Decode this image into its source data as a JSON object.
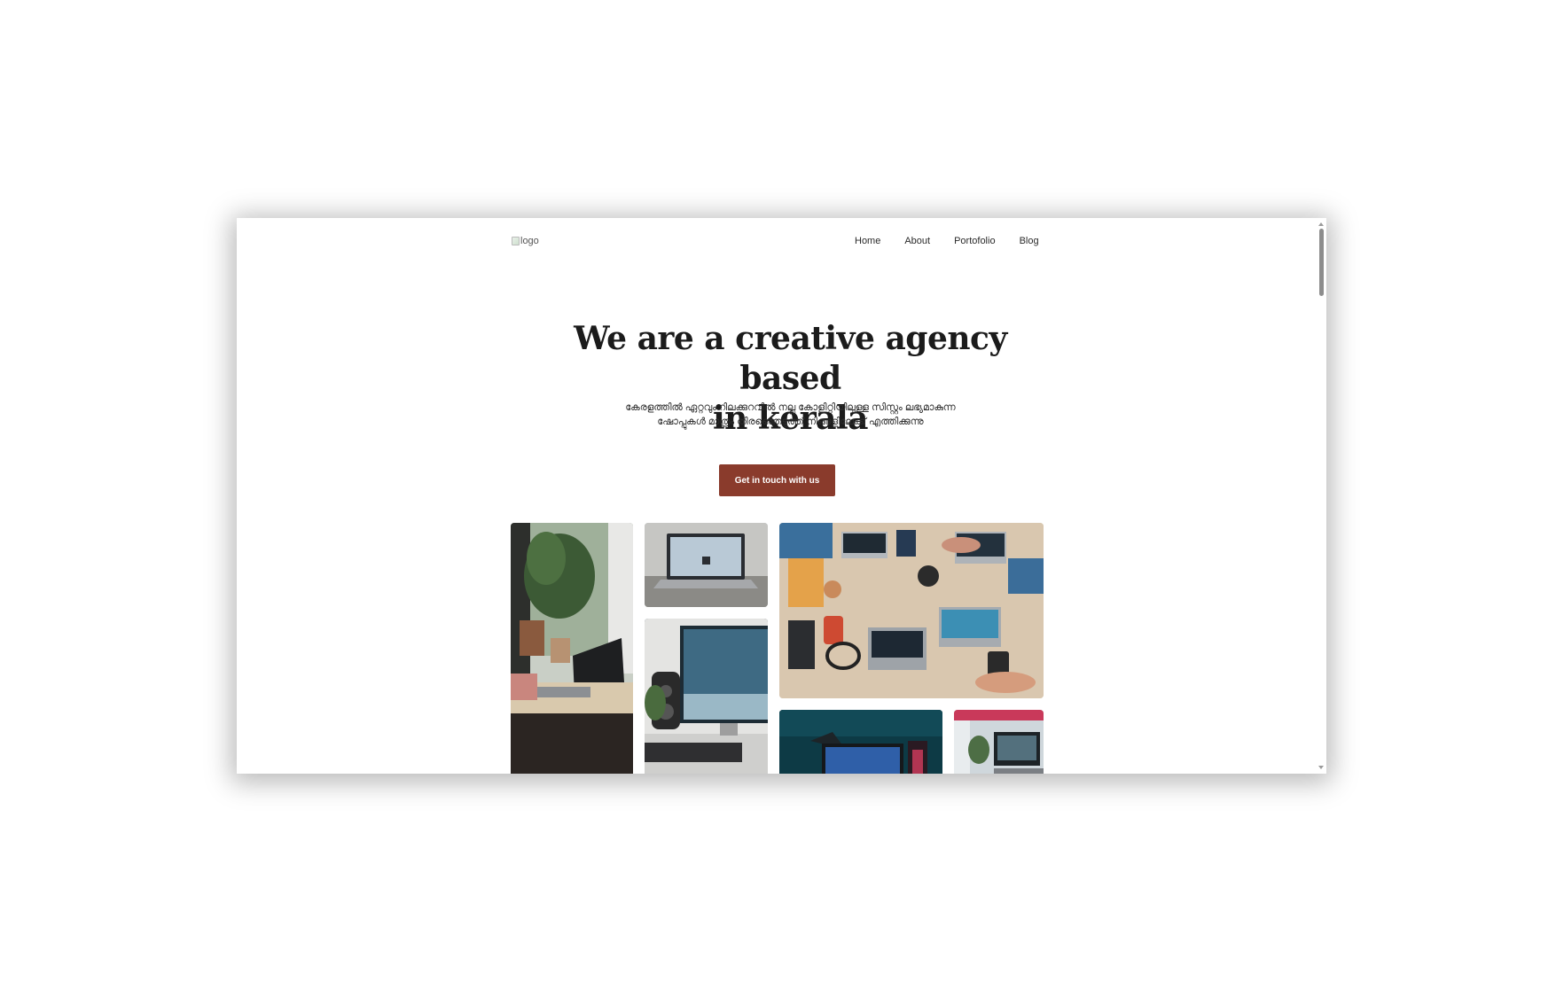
{
  "header": {
    "logo_alt": "logo",
    "nav": [
      {
        "label": "Home"
      },
      {
        "label": "About"
      },
      {
        "label": "Portofolio"
      },
      {
        "label": "Blog"
      }
    ]
  },
  "hero": {
    "title_line1": "We are a creative agency based",
    "title_line2": "in kerala",
    "subtitle_line1": "കേരളത്തിൽ ഏറ്റവും റിലക്കുറവിൽ നല്ല കോളിറ്റിയിലുള്ള സിസ്റ്റം ലഭ്യമാകുന്ന",
    "subtitle_line2": "ഷോപ്പുകൾ മാത്രം തിരഞ്ഞെടുത്ത് നിങ്ങളിലേക്ക് എത്തിക്കുന്നു",
    "cta_label": "Get in touch with us"
  },
  "theme": {
    "accent": "#8a3b2c",
    "text": "#1b1b1b"
  },
  "gallery": [
    {
      "subject": "desk-with-plants-and-laptop"
    },
    {
      "subject": "laptop-on-table"
    },
    {
      "subject": "monitor-and-speaker"
    },
    {
      "subject": "top-view-team-laptops"
    },
    {
      "subject": "gaming-pc-teal"
    },
    {
      "subject": "desk-setup-window"
    }
  ]
}
